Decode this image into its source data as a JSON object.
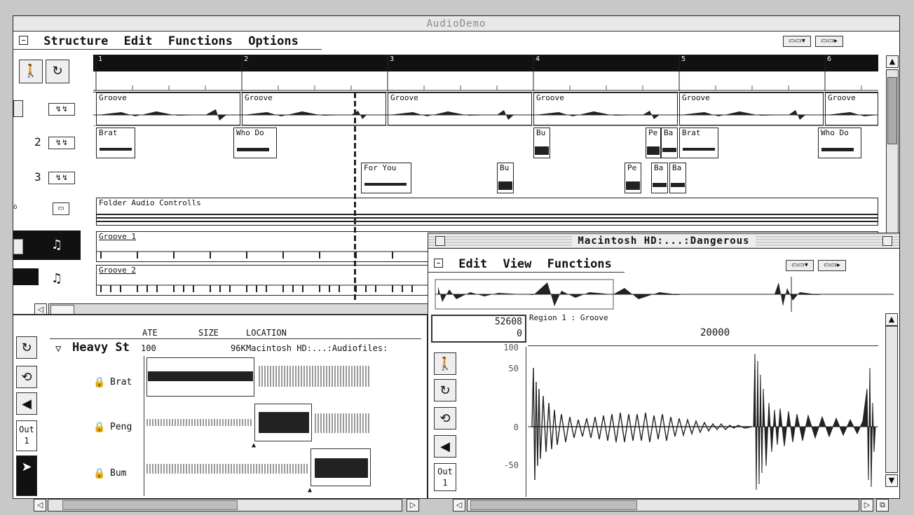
{
  "main_window": {
    "title": "AudioDemo",
    "menu": [
      "Structure",
      "Edit",
      "Functions",
      "Options"
    ],
    "ruler_marks": [
      "1",
      "2",
      "3",
      "4",
      "5",
      "6"
    ],
    "track_numbers": [
      "2",
      "3"
    ],
    "groove_label": "Groove",
    "regions_row2": [
      "Brat",
      "Who Do",
      "Bu",
      "Pe",
      "Ba",
      "Brat",
      "Who Do"
    ],
    "regions_row3": [
      "For You",
      "Bu",
      "Pe",
      "Ba",
      "Ba"
    ],
    "folder_label": "Folder Audio Controlls",
    "midi_tracks": [
      "Groove 1",
      "Groove 2"
    ]
  },
  "audio_window": {
    "folder_name": "Heavy St",
    "columns": [
      "ATE",
      "SIZE",
      "LOCATION"
    ],
    "row_rate": "100",
    "row_size": "96K",
    "row_location": "Macintosh HD:...:Audiofiles:",
    "files": [
      "Brat",
      "Peng",
      "Bum"
    ],
    "out_label": "Out",
    "out_value": "1"
  },
  "sample_window": {
    "title": "Macintosh HD:...:Dangerous",
    "menu": [
      "Edit",
      "View",
      "Functions"
    ],
    "position_value": "52608",
    "position_sub": "0",
    "region_label": "Region 1 : Groove",
    "ruler_value": "20000",
    "y_ticks": [
      "100",
      "50",
      "0",
      "-50"
    ],
    "out_label": "Out",
    "out_value": "1"
  },
  "icons": {
    "walk": "walking-figure-icon",
    "loop": "loop-arrows-icon",
    "speaker": "speaker-icon",
    "arrow": "pointer-arrow-icon"
  }
}
